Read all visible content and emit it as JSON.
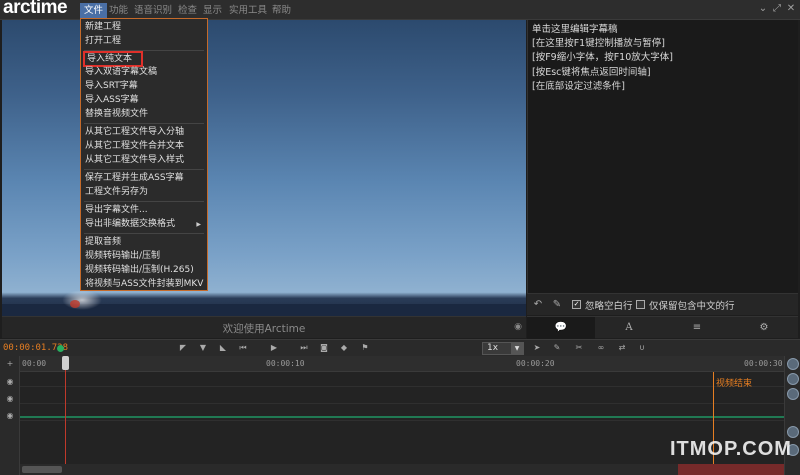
{
  "app": {
    "logo_text": "arctime"
  },
  "menubar": {
    "items": [
      {
        "label": "文件",
        "active": true
      },
      {
        "label": "功能"
      },
      {
        "label": "语音识别"
      },
      {
        "label": "检查"
      },
      {
        "label": "显示"
      },
      {
        "label": "实用工具"
      },
      {
        "label": "帮助"
      }
    ]
  },
  "window_controls": {
    "dropdown_icon": "chevron-down-icon",
    "restore_icon": "restore-icon",
    "close_icon": "close-icon"
  },
  "file_menu": {
    "items": [
      "新建工程",
      "打开工程",
      "导入纯文本",
      "导入双语字幕文稿",
      "导入SRT字幕",
      "导入ASS字幕",
      "替换音视频文件",
      "从其它工程文件导入分轴",
      "从其它工程文件合并文本",
      "从其它工程文件导入样式",
      "保存工程并生成ASS字幕",
      "工程文件另存为",
      "导出字幕文件...",
      "导出非编数据交换格式",
      "提取音频",
      "视频转码输出/压制",
      "视频转码输出/压制(H.265)",
      "将视频与ASS文件封装到MKV"
    ],
    "highlighted_index": 2,
    "submenu_index": 13
  },
  "video": {
    "welcome_text": "欢迎使用Arctime"
  },
  "subtitle_panel": {
    "lines": [
      "单击这里编辑字幕稿",
      "[在这里按F1键控制播放与暂停]",
      "[按F9缩小字体，按F10放大字体]",
      "[按Esc键将焦点返回时间轴]",
      "[在底部设定过滤条件]"
    ],
    "ignore_empty_label": "忽略空白行",
    "ignore_empty_checked": true,
    "keep_chinese_label": "仅保留包含中文的行",
    "keep_chinese_checked": false,
    "check_mark": "✓"
  },
  "tabs": {
    "items": [
      {
        "icon": "speech-bubble-icon",
        "glyph": "💬",
        "active": true
      },
      {
        "icon": "font-icon",
        "glyph": "A"
      },
      {
        "icon": "list-icon",
        "glyph": "≡"
      },
      {
        "icon": "gear-icon",
        "glyph": "⚙"
      }
    ]
  },
  "timeline": {
    "timecode": "00:00:01.728",
    "speed": "1x",
    "ruler_ticks": [
      "00:00",
      "00:00:10",
      "00:00:20",
      "00:00:30"
    ],
    "end_label": "视频结束"
  },
  "watermark": "ITMOP.COM",
  "colors": {
    "accent_orange": "#e67e22",
    "menu_active": "#4a6fa5",
    "highlight_red": "#e0302a",
    "waveform_green": "#1f8f5f"
  }
}
